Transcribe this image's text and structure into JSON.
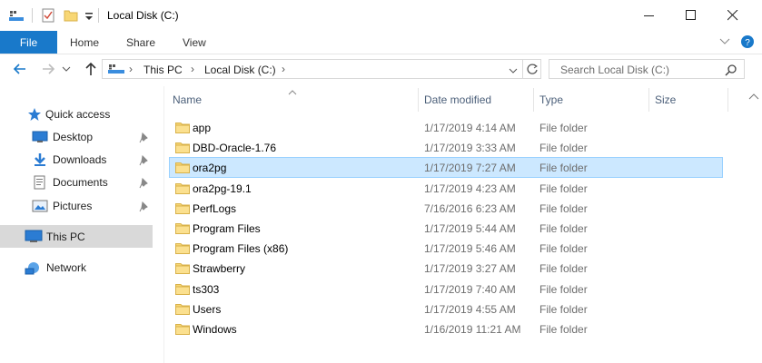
{
  "window": {
    "title": "Local Disk (C:)"
  },
  "ribbon": {
    "tabs": [
      "File",
      "Home",
      "Share",
      "View"
    ]
  },
  "address": {
    "segments": [
      "This PC",
      "Local Disk (C:)"
    ]
  },
  "search": {
    "placeholder": "Search Local Disk (C:)"
  },
  "nav": {
    "quick_access": "Quick access",
    "items": [
      {
        "label": "Desktop",
        "icon": "desktop-icon",
        "pinned": true
      },
      {
        "label": "Downloads",
        "icon": "downloads-icon",
        "pinned": true
      },
      {
        "label": "Documents",
        "icon": "documents-icon",
        "pinned": true
      },
      {
        "label": "Pictures",
        "icon": "pictures-icon",
        "pinned": true
      }
    ],
    "this_pc": "This PC",
    "network": "Network"
  },
  "columns": {
    "name": "Name",
    "date": "Date modified",
    "type": "Type",
    "size": "Size"
  },
  "files": [
    {
      "name": "app",
      "date": "1/17/2019 4:14 AM",
      "type": "File folder"
    },
    {
      "name": "DBD-Oracle-1.76",
      "date": "1/17/2019 3:33 AM",
      "type": "File folder"
    },
    {
      "name": "ora2pg",
      "date": "1/17/2019 7:27 AM",
      "type": "File folder"
    },
    {
      "name": "ora2pg-19.1",
      "date": "1/17/2019 4:23 AM",
      "type": "File folder"
    },
    {
      "name": "PerfLogs",
      "date": "7/16/2016 6:23 AM",
      "type": "File folder"
    },
    {
      "name": "Program Files",
      "date": "1/17/2019 5:44 AM",
      "type": "File folder"
    },
    {
      "name": "Program Files (x86)",
      "date": "1/17/2019 5:46 AM",
      "type": "File folder"
    },
    {
      "name": "Strawberry",
      "date": "1/17/2019 3:27 AM",
      "type": "File folder"
    },
    {
      "name": "ts303",
      "date": "1/17/2019 7:40 AM",
      "type": "File folder"
    },
    {
      "name": "Users",
      "date": "1/17/2019 4:55 AM",
      "type": "File folder"
    },
    {
      "name": "Windows",
      "date": "1/16/2019 11:21 AM",
      "type": "File folder"
    }
  ],
  "selected_index": 2,
  "colors": {
    "accent": "#1979ca",
    "selection": "#cce8ff",
    "folder": "#f8d775"
  }
}
